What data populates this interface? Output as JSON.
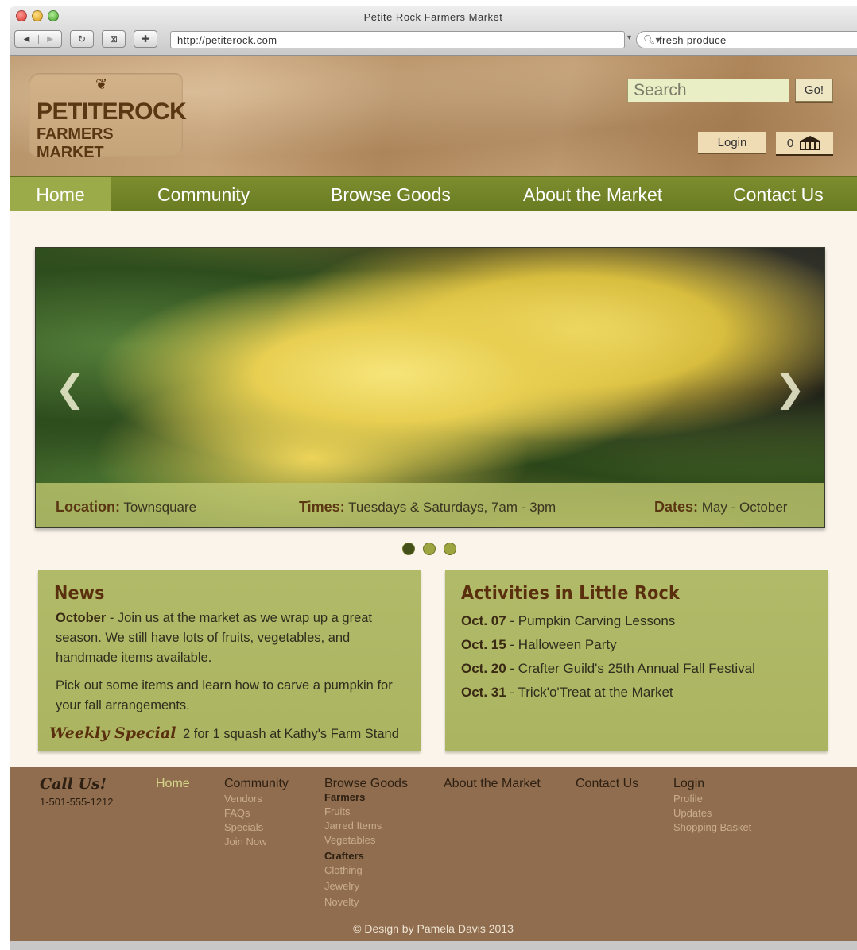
{
  "window": {
    "title": "Petite Rock Farmers Market",
    "url": "http://petiterock.com",
    "search_value": "fresh produce"
  },
  "header": {
    "logo_line1": "PETITEROCK",
    "logo_line2": "FARMERS MARKET",
    "search_placeholder": "Search",
    "go_label": "Go!",
    "login_label": "Login",
    "cart_count": "0"
  },
  "nav": {
    "items": [
      {
        "label": "Home"
      },
      {
        "label": "Community"
      },
      {
        "label": "Browse Goods"
      },
      {
        "label": "About the Market"
      },
      {
        "label": "Contact Us"
      }
    ]
  },
  "hero": {
    "location_label": "Location:",
    "location_value": "Townsquare",
    "times_label": "Times:",
    "times_value": "Tuesdays & Saturdays, 7am - 3pm",
    "dates_label": "Dates:",
    "dates_value": "May - October",
    "active_slide": 1,
    "slide_count": 3
  },
  "news": {
    "title": "News",
    "p1_bold": "October",
    "p1_text": " - Join us at the market as we wrap up a great season. We still have lots of fruits, vegetables, and handmade items available.",
    "p2_text": "Pick out some items and learn how to carve a pumpkin for your fall arrangements.",
    "weekly_label": "Weekly Special",
    "weekly_text": "2 for 1 squash at Kathy's Farm Stand"
  },
  "activities": {
    "title": "Activities in Little Rock",
    "items": [
      {
        "date": "Oct. 07",
        "text": " - Pumpkin Carving Lessons"
      },
      {
        "date": "Oct. 15",
        "text": " - Halloween Party"
      },
      {
        "date": "Oct. 20",
        "text": " - Crafter Guild's 25th Annual Fall Festival"
      },
      {
        "date": "Oct. 31",
        "text": " - Trick'o'Treat at the Market"
      }
    ]
  },
  "footer": {
    "call_label": "Call Us!",
    "phone": "1-501-555-1212",
    "home": "Home",
    "community": {
      "head": "Community",
      "links": [
        "Vendors",
        "FAQs",
        "Specials",
        "Join Now"
      ]
    },
    "browse": {
      "head": "Browse Goods",
      "farmers_label": "Farmers",
      "farmers_links": [
        "Fruits",
        "Jarred Items",
        "Vegetables"
      ],
      "crafters_label": "Crafters",
      "crafters_links": [
        "Clothing",
        "Jewelry",
        "Novelty"
      ]
    },
    "about": "About the Market",
    "contact": "Contact Us",
    "login": {
      "head": "Login",
      "links": [
        "Profile",
        "Updates",
        "Shopping Basket"
      ]
    },
    "credit": "© Design by Pamela Davis 2013"
  },
  "colors": {
    "nav_green": "#6a7c22",
    "nav_active": "#9bab4a",
    "card_green": "#b1ba68",
    "footer_brown": "#8f6d4e",
    "heading_brown": "#5a2f0e"
  }
}
